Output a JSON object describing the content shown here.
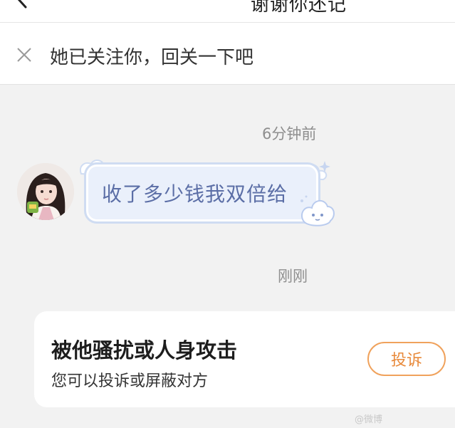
{
  "header": {
    "title": "谢谢你还记",
    "back_icon": "chevron-left-icon"
  },
  "banner": {
    "text": "她已关注你，回关一下吧",
    "close_icon": "close-icon"
  },
  "messages": [
    {
      "timestamp": "6分钟前",
      "text": "收了多少钱我双倍给",
      "sender": "other"
    }
  ],
  "second_timestamp": "刚刚",
  "report_card": {
    "title": "被他骚扰或人身攻击",
    "subtitle": "您可以投诉或屏蔽对方",
    "button_label": "投诉",
    "accent_color": "#e8893a"
  },
  "watermark": "@微博"
}
